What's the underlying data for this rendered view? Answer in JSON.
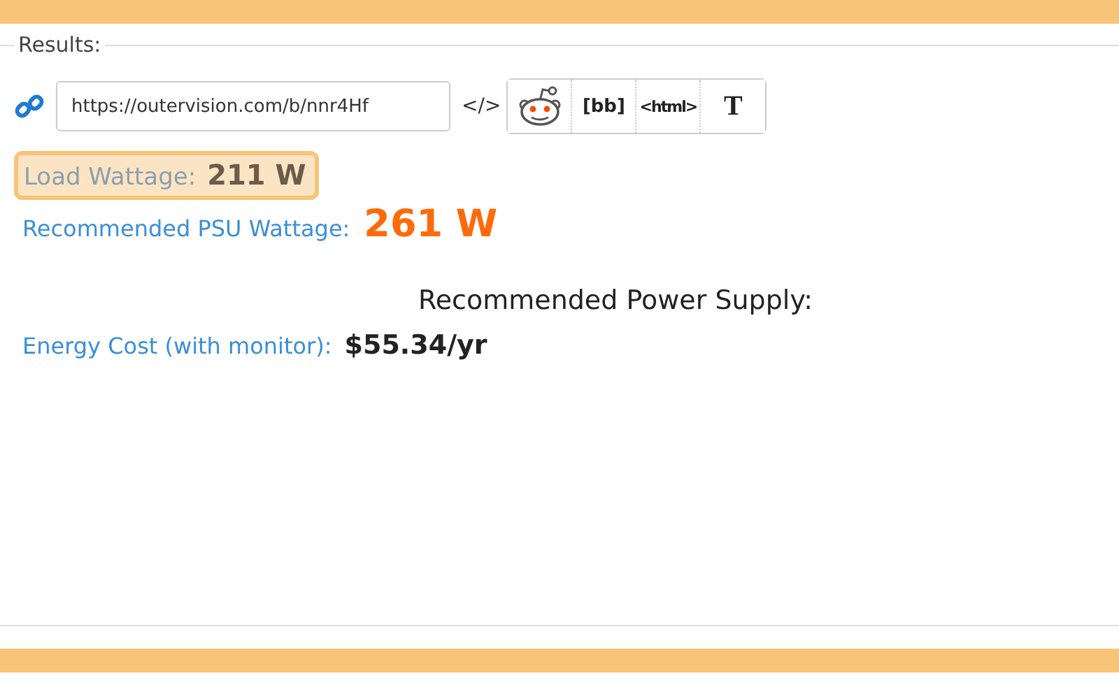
{
  "results": {
    "legend": "Results:",
    "share_url": "https://outervision.com/b/nnr4Hf",
    "embed_label": "</>",
    "share_buttons": [
      {
        "kind": "reddit"
      },
      {
        "kind": "text",
        "label": "[bb]"
      },
      {
        "kind": "html",
        "label": "<html>"
      },
      {
        "kind": "serif",
        "label": "T"
      }
    ],
    "load_wattage": {
      "label": "Load Wattage:",
      "value": "211 W",
      "highlighted": true
    },
    "psu_wattage": {
      "label": "Recommended PSU Wattage:",
      "value": "261 W"
    },
    "psu_heading": "Recommended Power Supply:",
    "energy_cost": {
      "label": "Energy Cost (with monitor):",
      "value": "$55.34/yr"
    }
  }
}
